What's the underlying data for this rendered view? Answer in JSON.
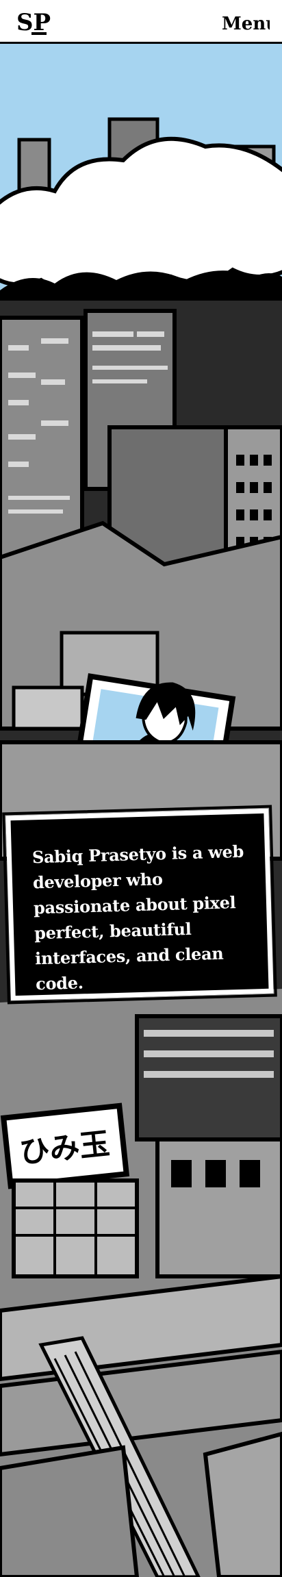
{
  "header": {
    "logo_text": "SP",
    "menu_label": "Menu"
  },
  "bio": {
    "text": "Sabiq Prasetyo is a web developer who passionate about pixel perfect, beautiful interfaces, and clean code."
  },
  "sign": {
    "text": "ひみ玉"
  },
  "colors": {
    "sky": "#a6d4f0",
    "ink": "#000000",
    "paper": "#ffffff",
    "building_gray": "#8a8a8a",
    "light_gray": "#c8c8c8"
  }
}
